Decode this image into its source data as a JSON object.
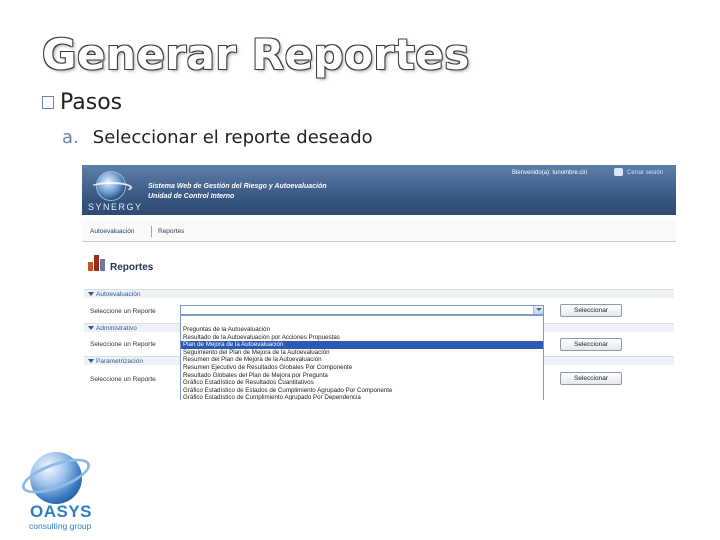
{
  "slide": {
    "title": "Generar Reportes",
    "bullet": "Pasos",
    "sub_letter": "a.",
    "sub_text": "Seleccionar el reporte deseado"
  },
  "app": {
    "logo_text": "SYNERGY",
    "name_line1": "Sistema Web de Gestión del Riesgo y Autoevaluación",
    "name_line2": "Unidad de Control Interno",
    "welcome": "Bienvenido(a): tunombre.ciri",
    "close_session": "Cerrar sesión",
    "menu": [
      "Autoevaluación",
      "Reportes"
    ],
    "page_heading": "Reportes",
    "sections": [
      {
        "label": "Autoevaluación",
        "row_label": "Seleccione un Reporte",
        "button": "Seleccionar"
      },
      {
        "label": "Administrativo",
        "row_label": "Seleccione un Reporte",
        "button": "Seleccionar"
      },
      {
        "label": "Parametrización",
        "row_label": "Seleccione un Reporte",
        "button": "Seleccionar"
      }
    ],
    "dropdown_options": [
      "Preguntas de la Autoevaluación",
      "Resultado de la Autoevaluación por Acciones Propuestas",
      "Plan de Mejora de la Autoevaluación",
      "Seguimiento del Plan de Mejora de la Autoevaluación",
      "Resumen del Plan de Mejora de la Autoevaluación",
      "Resumen Ejecutivo de Resultados Globales Por Componente",
      "Resultado Globales del Plan de Mejora por Pregunta",
      "Gráfico Estadístico de Resultados Cuantitativos",
      "Gráfico Estadístico de Estados de Cumplimiento Agrupado Por Componente",
      "Gráfico Estadístico de Cumplimiento Agrupado Por Dependencia"
    ],
    "selected_option_index": 2
  },
  "brand": {
    "name": "OASYS",
    "tagline": "consulting group"
  }
}
